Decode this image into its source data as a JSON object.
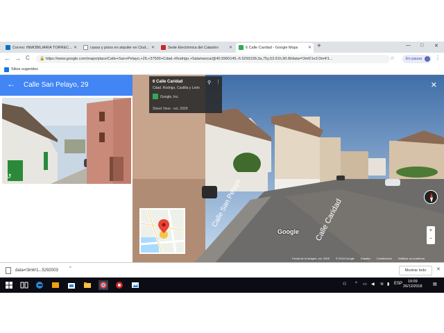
{
  "tabs": [
    {
      "label": "Correo: INMOBILIARIA TORREC...",
      "icon": "outlook-icon"
    },
    {
      "label": "casas y pisos en alquiler en Ciud...",
      "icon": "document-icon"
    },
    {
      "label": "Sede Electrónica del Catastro",
      "icon": "catastro-icon"
    },
    {
      "label": "6 Calle Caridad - Google Maps",
      "icon": "google-maps-icon"
    }
  ],
  "new_tab": "+",
  "window_controls": {
    "minimize": "—",
    "maximize": "□",
    "close": "✕"
  },
  "toolbar": {
    "back": "←",
    "forward": "→",
    "reload": "C",
    "url": "https://www.google.com/maps/place/Calle+San+Pelayo,+29,+37500+Cdad.+Rodrigo,+Salamanca/@40.5960145,-6.5293199,3a,75y,53.91h,90.8t/data=!3m6!1e1!3m4!1...",
    "star": "☆",
    "paused_label": "En pausa",
    "avatar_letter": "J",
    "menu": "⋮"
  },
  "bookmarks": {
    "label": "Sitios sugeridos"
  },
  "left_panel": {
    "back": "←",
    "title": "Calle San Pelayo, 29",
    "rotate_icon": "360-icon"
  },
  "street_view": {
    "info_title": "6 Calle Caridad",
    "info_subtitle": "Cdad. Rodrigo, Castilla y León",
    "info_provider": "Google, Inc.",
    "info_date": "Street View - oct. 2009",
    "pin": "⚲",
    "more": "⋮",
    "close": "✕",
    "google": "Google",
    "street_label_left": "Calle San Pelayo",
    "street_label_right": "Calle Caridad",
    "footer": [
      "Fecha de la imagen: oct. 2009",
      "© 2018 Google",
      "España",
      "Condiciones",
      "Notificar un problema"
    ],
    "zoom_in": "+",
    "zoom_out": "−"
  },
  "download_bar": {
    "filename": "data=!3m6!1...5292003",
    "chevron": "^",
    "show_all": "Mostrar todo",
    "close": "✕"
  },
  "taskbar": {
    "lang": "ESP",
    "time": "19:09",
    "date": "26/12/2018"
  },
  "colors": {
    "maps_blue": "#4285f4",
    "taskbar": "#0c0c14",
    "tabbar": "#dee1e6"
  }
}
